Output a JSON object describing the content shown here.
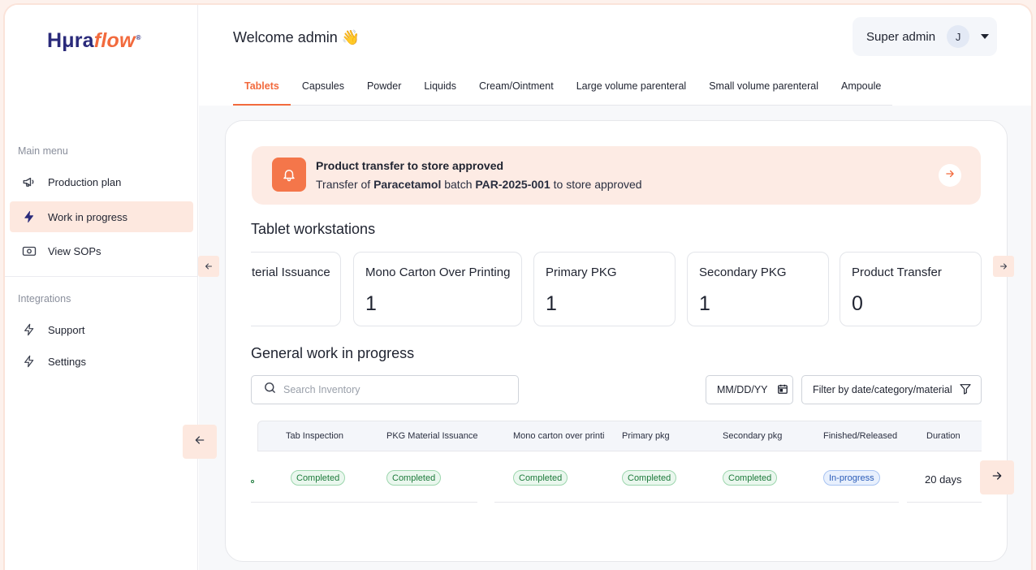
{
  "brand": {
    "logo_part1": "Hμra",
    "logo_part2": "flow",
    "logo_mark": "®"
  },
  "sidebar": {
    "main_heading": "Main menu",
    "main_items": [
      {
        "label": "Production plan",
        "icon": "megaphone-icon"
      },
      {
        "label": "Work in progress",
        "icon": "bolt-icon",
        "active": true
      },
      {
        "label": "View SOPs",
        "icon": "money-icon"
      }
    ],
    "integrations_heading": "Integrations",
    "integration_items": [
      {
        "label": "Support",
        "icon": "bolt-icon"
      },
      {
        "label": "Settings",
        "icon": "bolt-icon"
      }
    ]
  },
  "header": {
    "welcome": "Welcome admin 👋",
    "user_role": "Super admin",
    "user_initial": "J"
  },
  "tabs": [
    "Tablets",
    "Capsules",
    "Powder",
    "Liquids",
    "Cream/Ointment",
    "Large volume parenteral",
    "Small volume parenteral",
    "Ampoule"
  ],
  "active_tab": "Tablets",
  "notification": {
    "title": "Product transfer to store approved",
    "prefix": "Transfer of ",
    "product": "Paracetamol",
    "middle": " batch ",
    "batch": "PAR-2025-001",
    "suffix": " to store approved"
  },
  "workstations": {
    "title": "Tablet workstations",
    "cards": [
      {
        "label": "terial Issuance",
        "value": ""
      },
      {
        "label": "Mono Carton Over Printing",
        "value": "1"
      },
      {
        "label": "Primary PKG",
        "value": "1"
      },
      {
        "label": "Secondary PKG",
        "value": "1"
      },
      {
        "label": "Product Transfer",
        "value": "0"
      }
    ]
  },
  "general": {
    "title": "General work in progress",
    "search_placeholder": "Search Inventory",
    "date_placeholder": "MM/DD/YY",
    "filter_label": "Filter by date/category/material",
    "columns": [
      "Tab Inspection",
      "PKG Material Issuance",
      "Mono carton over printing",
      "Primary pkg",
      "Secondary pkg",
      "Finished/Released",
      "Duration"
    ],
    "row": {
      "statuses": [
        "Completed",
        "Completed",
        "Completed",
        "Completed",
        "Completed",
        "In-progress"
      ],
      "duration": "20 days"
    }
  },
  "colors": {
    "accent": "#f26a3d",
    "accent_soft": "#fde8df",
    "brand_navy": "#2a2a7a",
    "success": "#1d7a3b",
    "info": "#2a5bb8"
  }
}
